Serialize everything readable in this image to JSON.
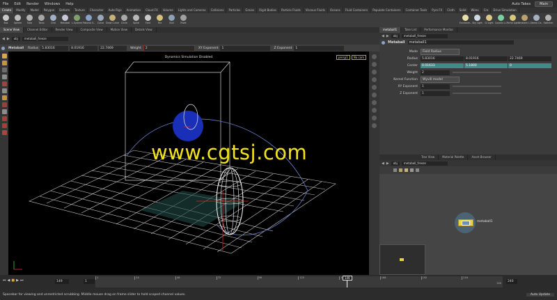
{
  "menu": {
    "items": [
      "File",
      "Edit",
      "Render",
      "Windows",
      "Help"
    ],
    "auto_takes": "Auto Takes",
    "desktop": "Main"
  },
  "shelf_tabs": [
    "Create",
    "Modify",
    "Model",
    "Polygon",
    "Deform",
    "Texture",
    "Character",
    "Auto Rigs",
    "Animation",
    "Cloud FX",
    "Volume",
    "Lights and Cameras",
    "Collisions",
    "Particles",
    "Grains",
    "Rigid Bodies",
    "Particle Fluids",
    "Viscous Fluids",
    "Oceans",
    "Fluid Containers",
    "Populate Containers",
    "Container Tools",
    "Pyro FX",
    "Cloth",
    "Solid",
    "Wires",
    "Cre",
    "Drive Simulation"
  ],
  "shelf_tools": [
    {
      "label": "Box",
      "icon": "box-icon",
      "color": "#c9c9c9"
    },
    {
      "label": "Sphere",
      "icon": "sphere-icon",
      "color": "#bdbdbd"
    },
    {
      "label": "Tube",
      "icon": "tube-icon",
      "color": "#b0b0b0"
    },
    {
      "label": "Torus",
      "icon": "torus-icon",
      "color": "#a6a6a6"
    },
    {
      "label": "Grid",
      "icon": "grid-icon",
      "color": "#9fb0c7"
    },
    {
      "label": "Metaball",
      "icon": "metaball-icon",
      "color": "#c6c6d8"
    },
    {
      "label": "L-System",
      "icon": "lsystem-icon",
      "color": "#7fa06d"
    },
    {
      "label": "Platonic S..",
      "icon": "platonic-icon",
      "color": "#8aa0c6"
    },
    {
      "label": "Curve",
      "icon": "curve-icon",
      "color": "#9aa7b7"
    },
    {
      "label": "Draw Curve",
      "icon": "draw-curve-icon",
      "color": "#c7b07a"
    },
    {
      "label": "Circle",
      "icon": "circle-icon",
      "color": "#a9a9a9"
    },
    {
      "label": "Spiral",
      "icon": "spiral-icon",
      "color": "#b7b7b7"
    },
    {
      "label": "Font",
      "icon": "font-icon",
      "color": "#c9c9c9"
    },
    {
      "label": "File",
      "icon": "file-icon",
      "color": "#d4c07c"
    },
    {
      "label": "Null",
      "icon": "null-icon",
      "color": "#8fa2b5"
    },
    {
      "label": "Rivet",
      "icon": "rivet-icon",
      "color": "#a0a0a0"
    }
  ],
  "light_tools": [
    {
      "label": "Environm..",
      "icon": "environment-light-icon",
      "color": "#e8e0a8"
    },
    {
      "label": "Sky Light",
      "icon": "sky-light-icon",
      "color": "#cfd9e2"
    },
    {
      "label": "GI Light",
      "icon": "gi-light-icon",
      "color": "#d9c88a"
    },
    {
      "label": "Caustic Li..",
      "icon": "caustic-light-icon",
      "color": "#7ad0a0"
    },
    {
      "label": "Portal Light",
      "icon": "portal-light-icon",
      "color": "#d5c87a"
    },
    {
      "label": "Ambient L..",
      "icon": "ambient-light-icon",
      "color": "#b8a16c"
    },
    {
      "label": "Stereo Ca..",
      "icon": "stereo-camera-icon",
      "color": "#a4b0bd"
    },
    {
      "label": "Switcher",
      "icon": "switcher-icon",
      "color": "#b3b3b3"
    }
  ],
  "pane_tabs": [
    "Scene View",
    "Channel Editor",
    "Render View",
    "Composite View",
    "Motion View",
    "Details View"
  ],
  "path": {
    "context": "obj",
    "node": "metaball_freeze"
  },
  "opbar": {
    "node_type": "Metaball",
    "radius_label": "Radius",
    "radius": [
      "5.83016",
      "8.01916",
      "22.7469"
    ],
    "weight_label": "Weight",
    "weight": "2",
    "xy_exp_label": "XY Exponent",
    "xy_exp": "1",
    "z_exp_label": "Z Exponent",
    "z_exp": "1"
  },
  "viewport": {
    "status": "Dynamics Simulation Disabled",
    "camera": "persp1",
    "cam_menu": "No cam",
    "watermark": "www.cgtsj.com"
  },
  "right_tabs": [
    "metaball1",
    "Take List",
    "Performance Monitor"
  ],
  "params": {
    "path": {
      "context": "obj",
      "node": "metaball_freeze"
    },
    "node_type": "Metaball",
    "node_name": "metaball1",
    "rows": [
      {
        "label": "Mode",
        "values": [
          "Field Radius"
        ],
        "kind": "menu"
      },
      {
        "label": "Radius",
        "values": [
          "5.83016",
          "8.01916",
          "22.7469"
        ],
        "kind": "plain"
      },
      {
        "label": "Center",
        "values": [
          "0.01633",
          "5.1800",
          "0"
        ],
        "kind": "teal"
      },
      {
        "label": "Weight",
        "values": [
          "2"
        ],
        "kind": "slider"
      },
      {
        "label": "Kernel Function",
        "values": [
          "Wyvill model"
        ],
        "kind": "menu"
      },
      {
        "label": "XY Exponent",
        "values": [
          "1"
        ],
        "kind": "slider"
      },
      {
        "label": "Z Exponent",
        "values": [
          "1"
        ],
        "kind": "slider"
      }
    ]
  },
  "net_tabs": [
    "Tree View",
    "Material Palette",
    "Asset Browser"
  ],
  "net_path": {
    "context": "obj",
    "node": "metaball_freeze"
  },
  "net_node": {
    "label": "metaball1"
  },
  "timeline": {
    "current_frame": "149",
    "start": "1",
    "end": "240",
    "end_field": "240",
    "ticks": [
      "1",
      "24",
      "48",
      "72",
      "96",
      "120",
      "144",
      "168",
      "192",
      "216"
    ],
    "playhead_fraction": 0.617
  },
  "help_text": "Spacebar for viewing and unrestricted scrubbing. Middle mouse drag on frame slider to hold scoped channel values.",
  "update_mode": "Auto Update"
}
